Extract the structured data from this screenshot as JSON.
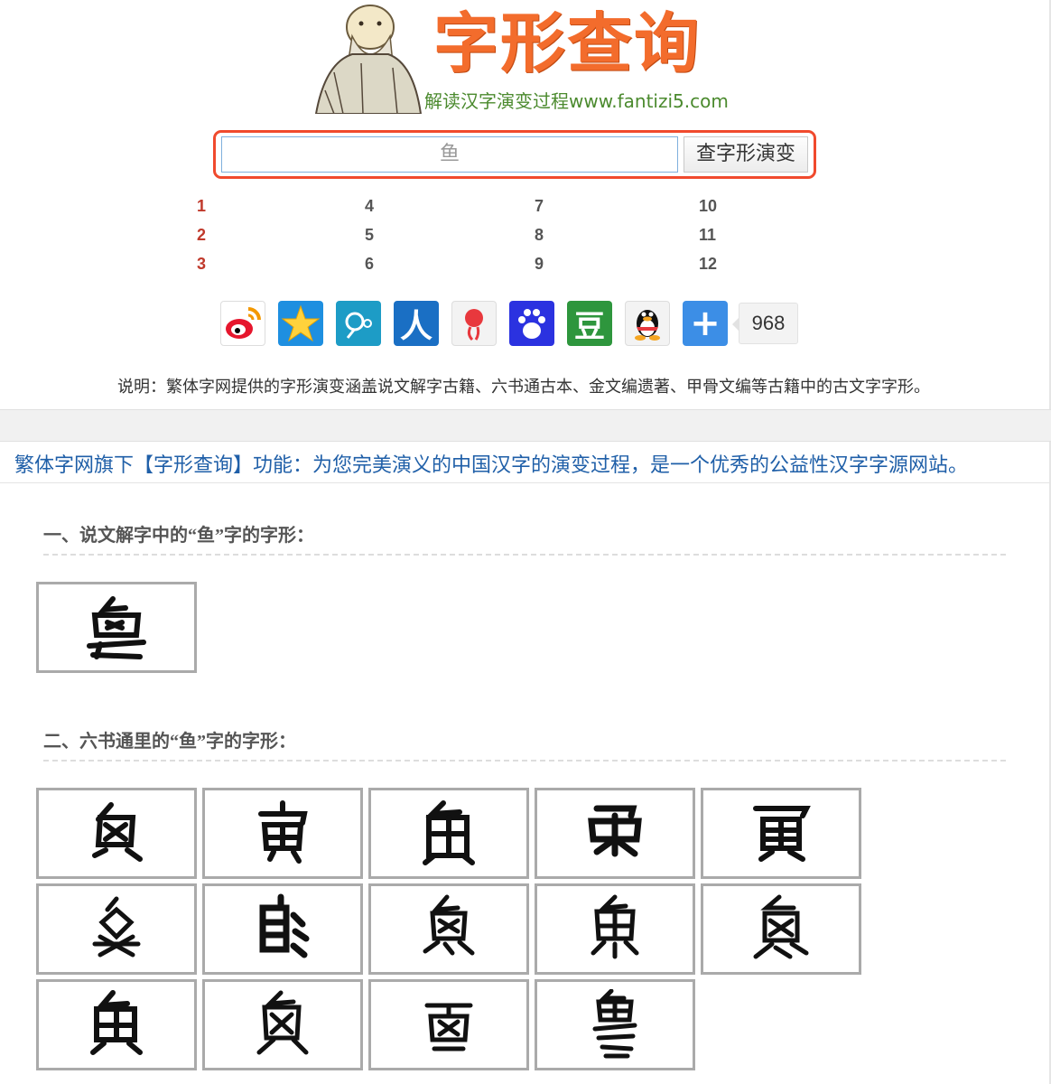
{
  "header": {
    "logo_title": "字形查询",
    "logo_subtitle": "解读汉字演变过程www.fantizi5.com"
  },
  "search": {
    "value": "鱼",
    "button_label": "查字形演变"
  },
  "number_links": [
    {
      "label": "1",
      "color": "#c0392b"
    },
    {
      "label": "2",
      "color": "#c0392b"
    },
    {
      "label": "3",
      "color": "#c0392b"
    },
    {
      "label": "4",
      "color": "#555555"
    },
    {
      "label": "5",
      "color": "#555555"
    },
    {
      "label": "6",
      "color": "#555555"
    },
    {
      "label": "7",
      "color": "#555555"
    },
    {
      "label": "8",
      "color": "#555555"
    },
    {
      "label": "9",
      "color": "#555555"
    },
    {
      "label": "10",
      "color": "#555555"
    },
    {
      "label": "11",
      "color": "#555555"
    },
    {
      "label": "12",
      "color": "#555555"
    }
  ],
  "share": {
    "icons": [
      "weibo-icon",
      "qzone-icon",
      "tencent-weibo-icon",
      "renren-icon",
      "kaixin-icon",
      "baidu-icon",
      "douban-icon",
      "qq-icon",
      "more-icon"
    ],
    "count": "968"
  },
  "description": "说明：繁体字网提供的字形演变涵盖说文解字古籍、六书通古本、金文编遗著、甲骨文编等古籍中的古文字字形。",
  "slogan": "繁体字网旗下【字形查询】功能：为您完美演义的中国汉字的演变过程，是一个优秀的公益性汉字字源网站。",
  "sections": [
    {
      "title": "一、说文解字中的“鱼”字的字形：",
      "glyph_count": 1
    },
    {
      "title": "二、六书通里的“鱼”字的字形：",
      "glyph_count": 14
    }
  ],
  "colors": {
    "accent_orange": "#f36c2c",
    "search_border": "#f04a2d",
    "slogan_blue": "#1f5fa8"
  }
}
